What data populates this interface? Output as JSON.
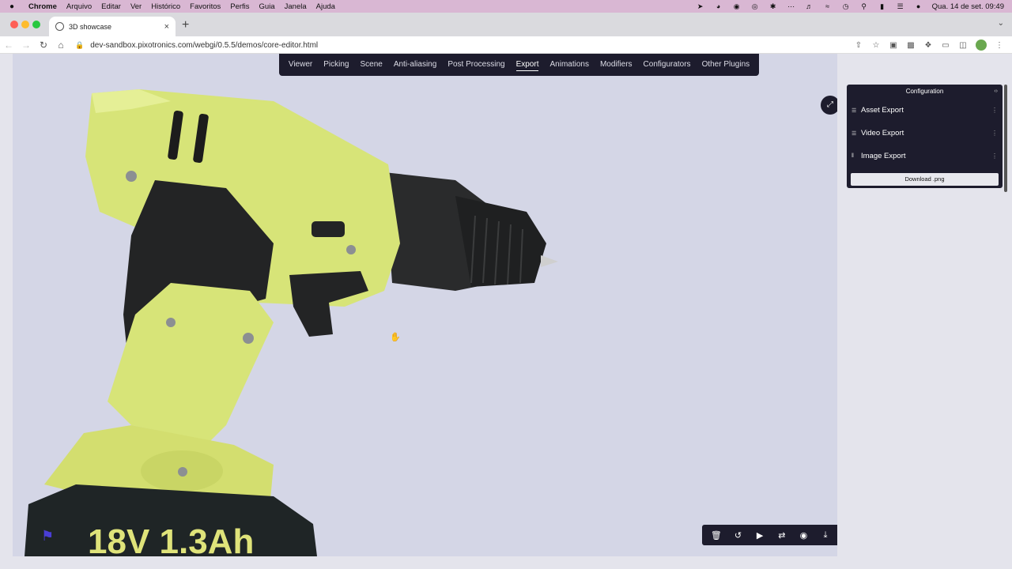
{
  "menubar": {
    "apple": "",
    "app_name": "Chrome",
    "items": [
      "Arquivo",
      "Editar",
      "Ver",
      "Histórico",
      "Favoritos",
      "Perfis",
      "Guia",
      "Janela",
      "Ajuda"
    ],
    "clock": "Qua. 14 de set.  09:49"
  },
  "browser": {
    "tab_title": "3D showcase",
    "tab_close": "×",
    "new_tab": "+",
    "url": "dev-sandbox.pixotronics.com/webgi/0.5.5/demos/core-editor.html"
  },
  "app": {
    "nav": [
      "Viewer",
      "Picking",
      "Scene",
      "Anti-aliasing",
      "Post Processing",
      "Export",
      "Animations",
      "Modifiers",
      "Configurators",
      "Other Plugins"
    ],
    "active_nav": "Export",
    "config": {
      "title": "Configuration",
      "sections": [
        "Asset Export",
        "Video Export",
        "Image Export"
      ],
      "download_label": "Download .png"
    },
    "product_label": "18V  1.3Ah"
  }
}
